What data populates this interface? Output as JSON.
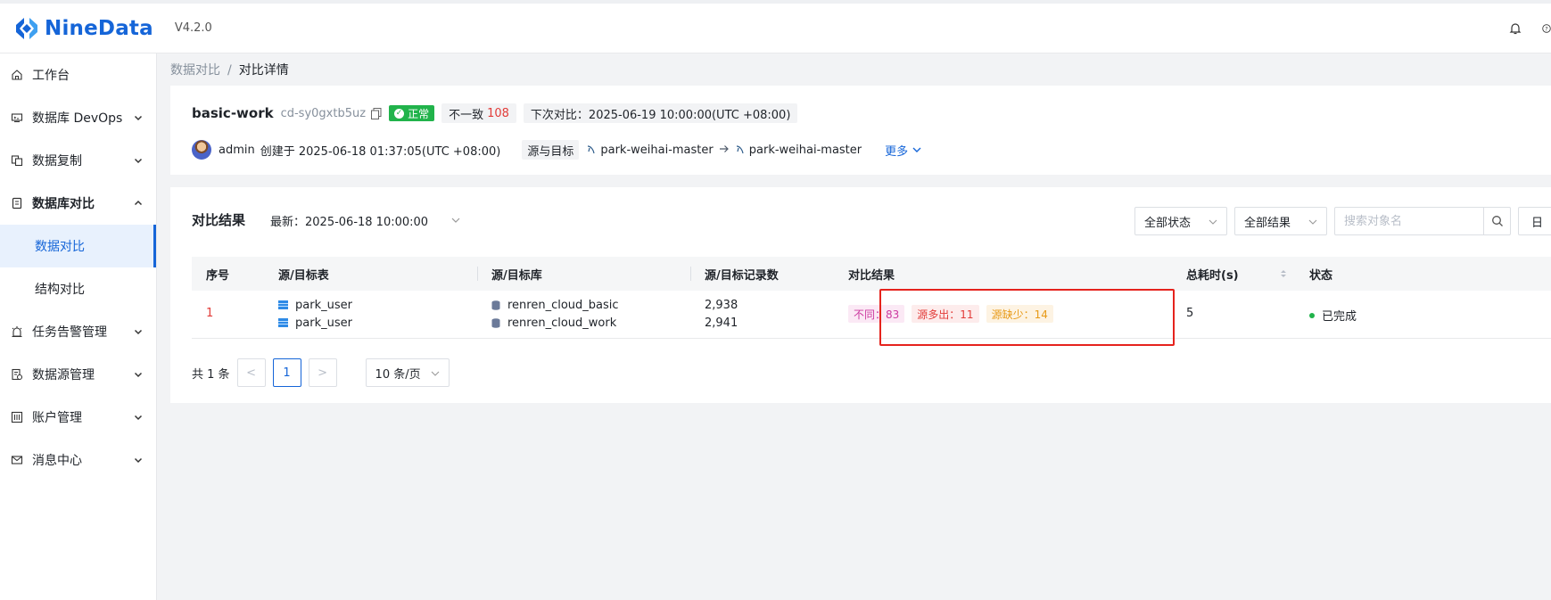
{
  "app": {
    "name": "NineData",
    "version": "V4.2.0",
    "brand_color": "#1565d8"
  },
  "topbar": {
    "icons": [
      "bell-icon",
      "help-icon"
    ]
  },
  "sidebar": {
    "items": [
      {
        "label": "工作台",
        "icon": "home-icon"
      },
      {
        "label": "数据库 DevOps",
        "icon": "devops-icon"
      },
      {
        "label": "数据复制",
        "icon": "replication-icon"
      },
      {
        "label": "数据库对比",
        "icon": "compare-icon"
      },
      {
        "label": "任务告警管理",
        "icon": "alarm-icon"
      },
      {
        "label": "数据源管理",
        "icon": "datasource-icon"
      },
      {
        "label": "账户管理",
        "icon": "account-icon"
      },
      {
        "label": "消息中心",
        "icon": "message-icon"
      }
    ],
    "sub_items": [
      {
        "label": "数据对比",
        "active": true
      },
      {
        "label": "结构对比",
        "active": false
      }
    ]
  },
  "breadcrumb": {
    "parent": "数据对比",
    "separator": "/",
    "current": "对比详情"
  },
  "task": {
    "name": "basic-work",
    "id": "cd-sy0gxtb5uz",
    "status": "正常",
    "inconsistent_label": "不一致",
    "inconsistent_count": "108",
    "next_compare": "下次对比：2025-06-19 10:00:00(UTC +08:00)",
    "creator": "admin",
    "created": "创建于 2025-06-18 01:37:05(UTC +08:00)",
    "source_target_label": "源与目标",
    "source_db": "park-weihai-master",
    "target_db": "park-weihai-master",
    "more_label": "更多"
  },
  "results": {
    "title": "对比结果",
    "latest": "最新：2025-06-18 10:00:00",
    "status_filter": "全部状态",
    "result_filter": "全部结果",
    "search_placeholder": "搜索对象名",
    "log_button": "日",
    "columns": [
      "序号",
      "源/目标表",
      "源/目标库",
      "源/目标记录数",
      "对比结果",
      "总耗时(s)",
      "状态"
    ],
    "rows": [
      {
        "index": "1",
        "source_table": "park_user",
        "target_table": "park_user",
        "source_db": "renren_cloud_basic",
        "target_db": "renren_cloud_work",
        "source_count": "2,938",
        "target_count": "2,941",
        "diff_badge": "不同：83",
        "more_badge": "源多出：11",
        "less_badge": "源缺少：14",
        "duration": "5",
        "status": "已完成"
      }
    ]
  },
  "pagination": {
    "total": "共 1 条",
    "prev": "<",
    "current": "1",
    "next": ">",
    "page_size": "10 条/页"
  }
}
